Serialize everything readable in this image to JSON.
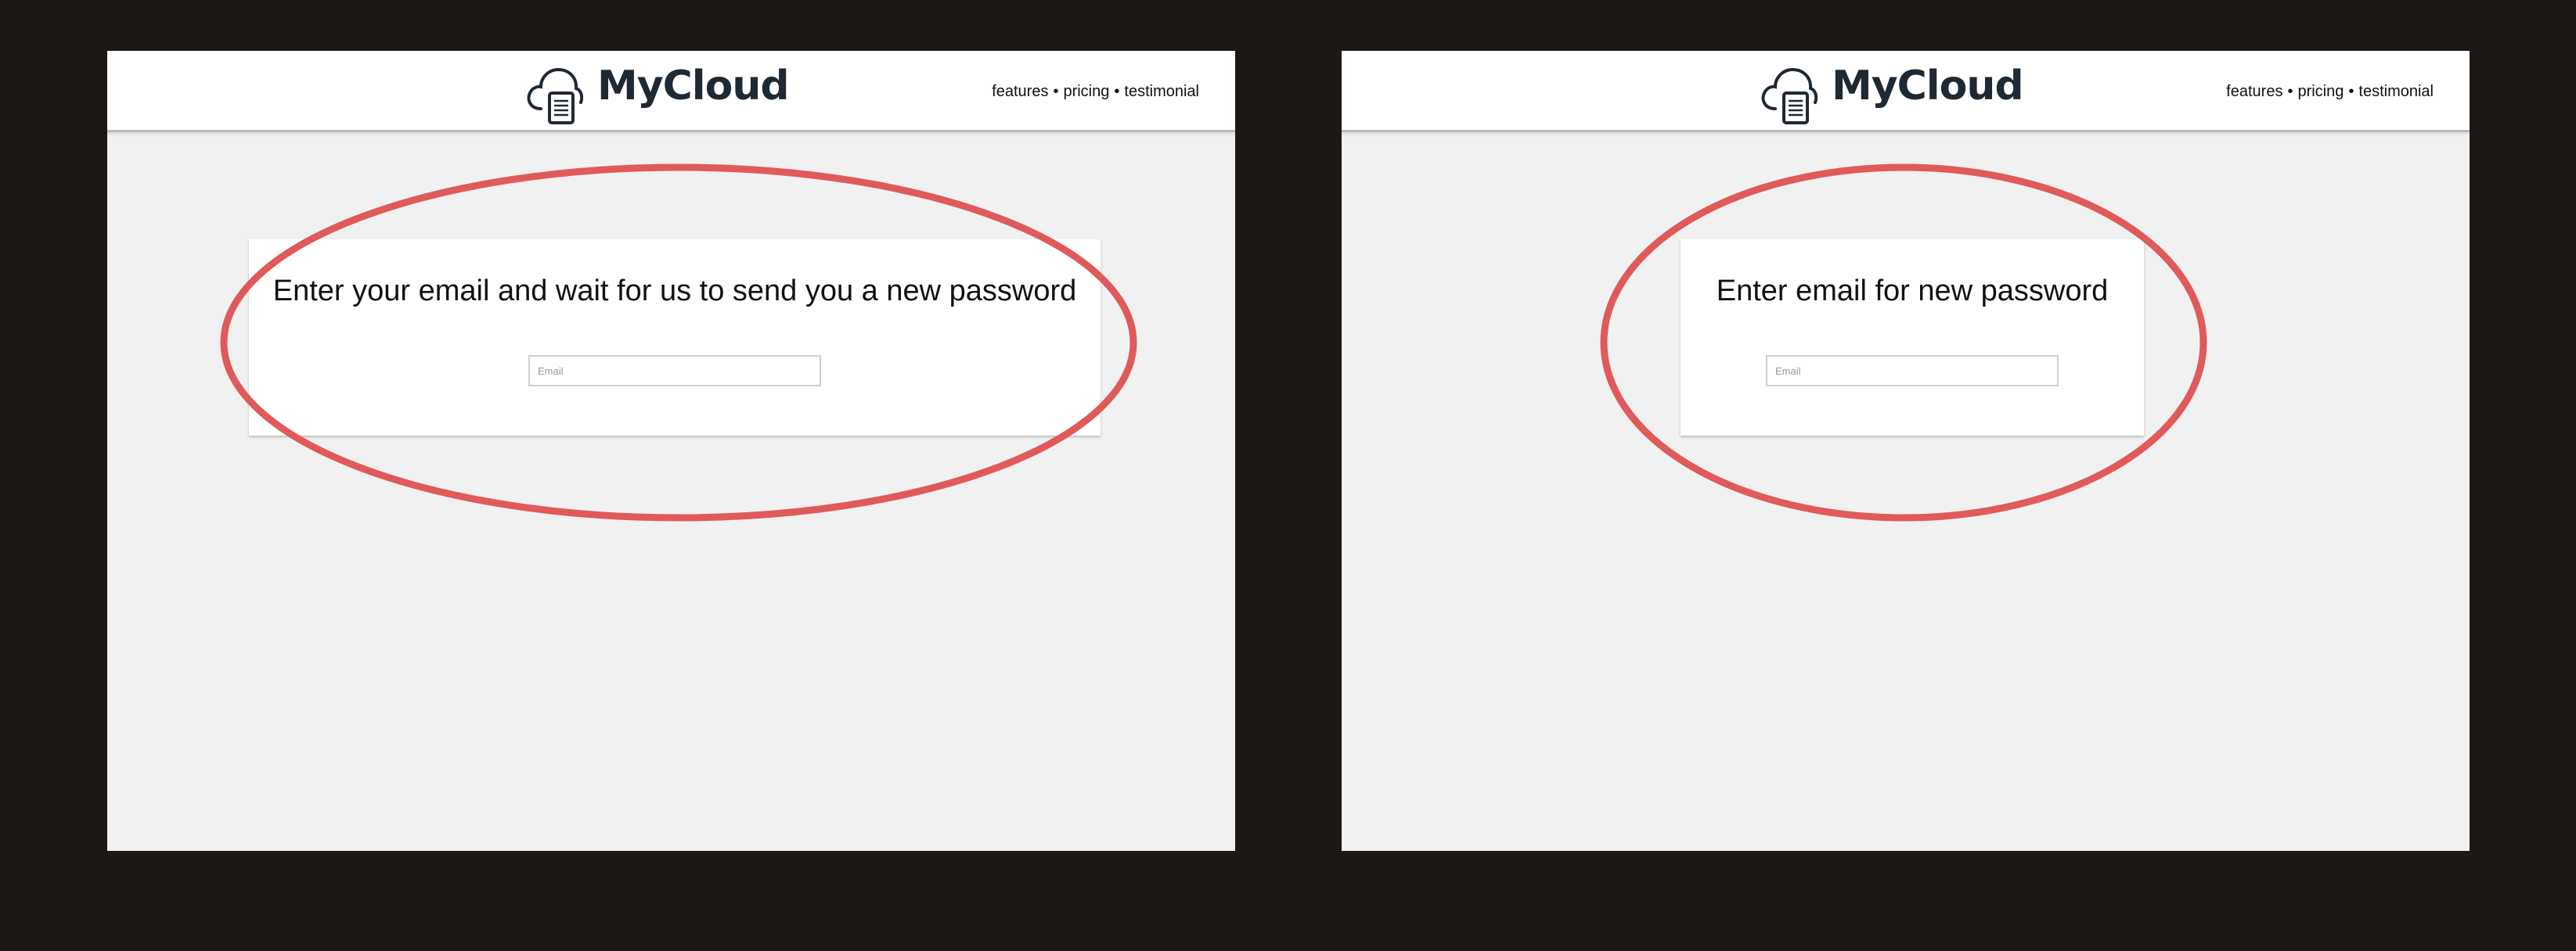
{
  "colors": {
    "backdrop": "#1c1815",
    "page_background": "#f1f1f1",
    "header_background": "#ffffff",
    "brand_text": "#1f2933",
    "annotation": "#e05a5a"
  },
  "screens": [
    {
      "header": {
        "brand": "MyCloud",
        "logo_icon": "cloud-document-icon",
        "nav": {
          "features": "features",
          "pricing": "pricing",
          "testimonial": "testimonial",
          "separator": "•"
        }
      },
      "card": {
        "title": "Enter your email and wait for us to send you a new password",
        "email_placeholder": "Email",
        "email_value": ""
      }
    },
    {
      "header": {
        "brand": "MyCloud",
        "logo_icon": "cloud-document-icon",
        "nav": {
          "features": "features",
          "pricing": "pricing",
          "testimonial": "testimonial",
          "separator": "•"
        }
      },
      "card": {
        "title": "Enter email for new password",
        "email_placeholder": "Email",
        "email_value": ""
      }
    }
  ]
}
